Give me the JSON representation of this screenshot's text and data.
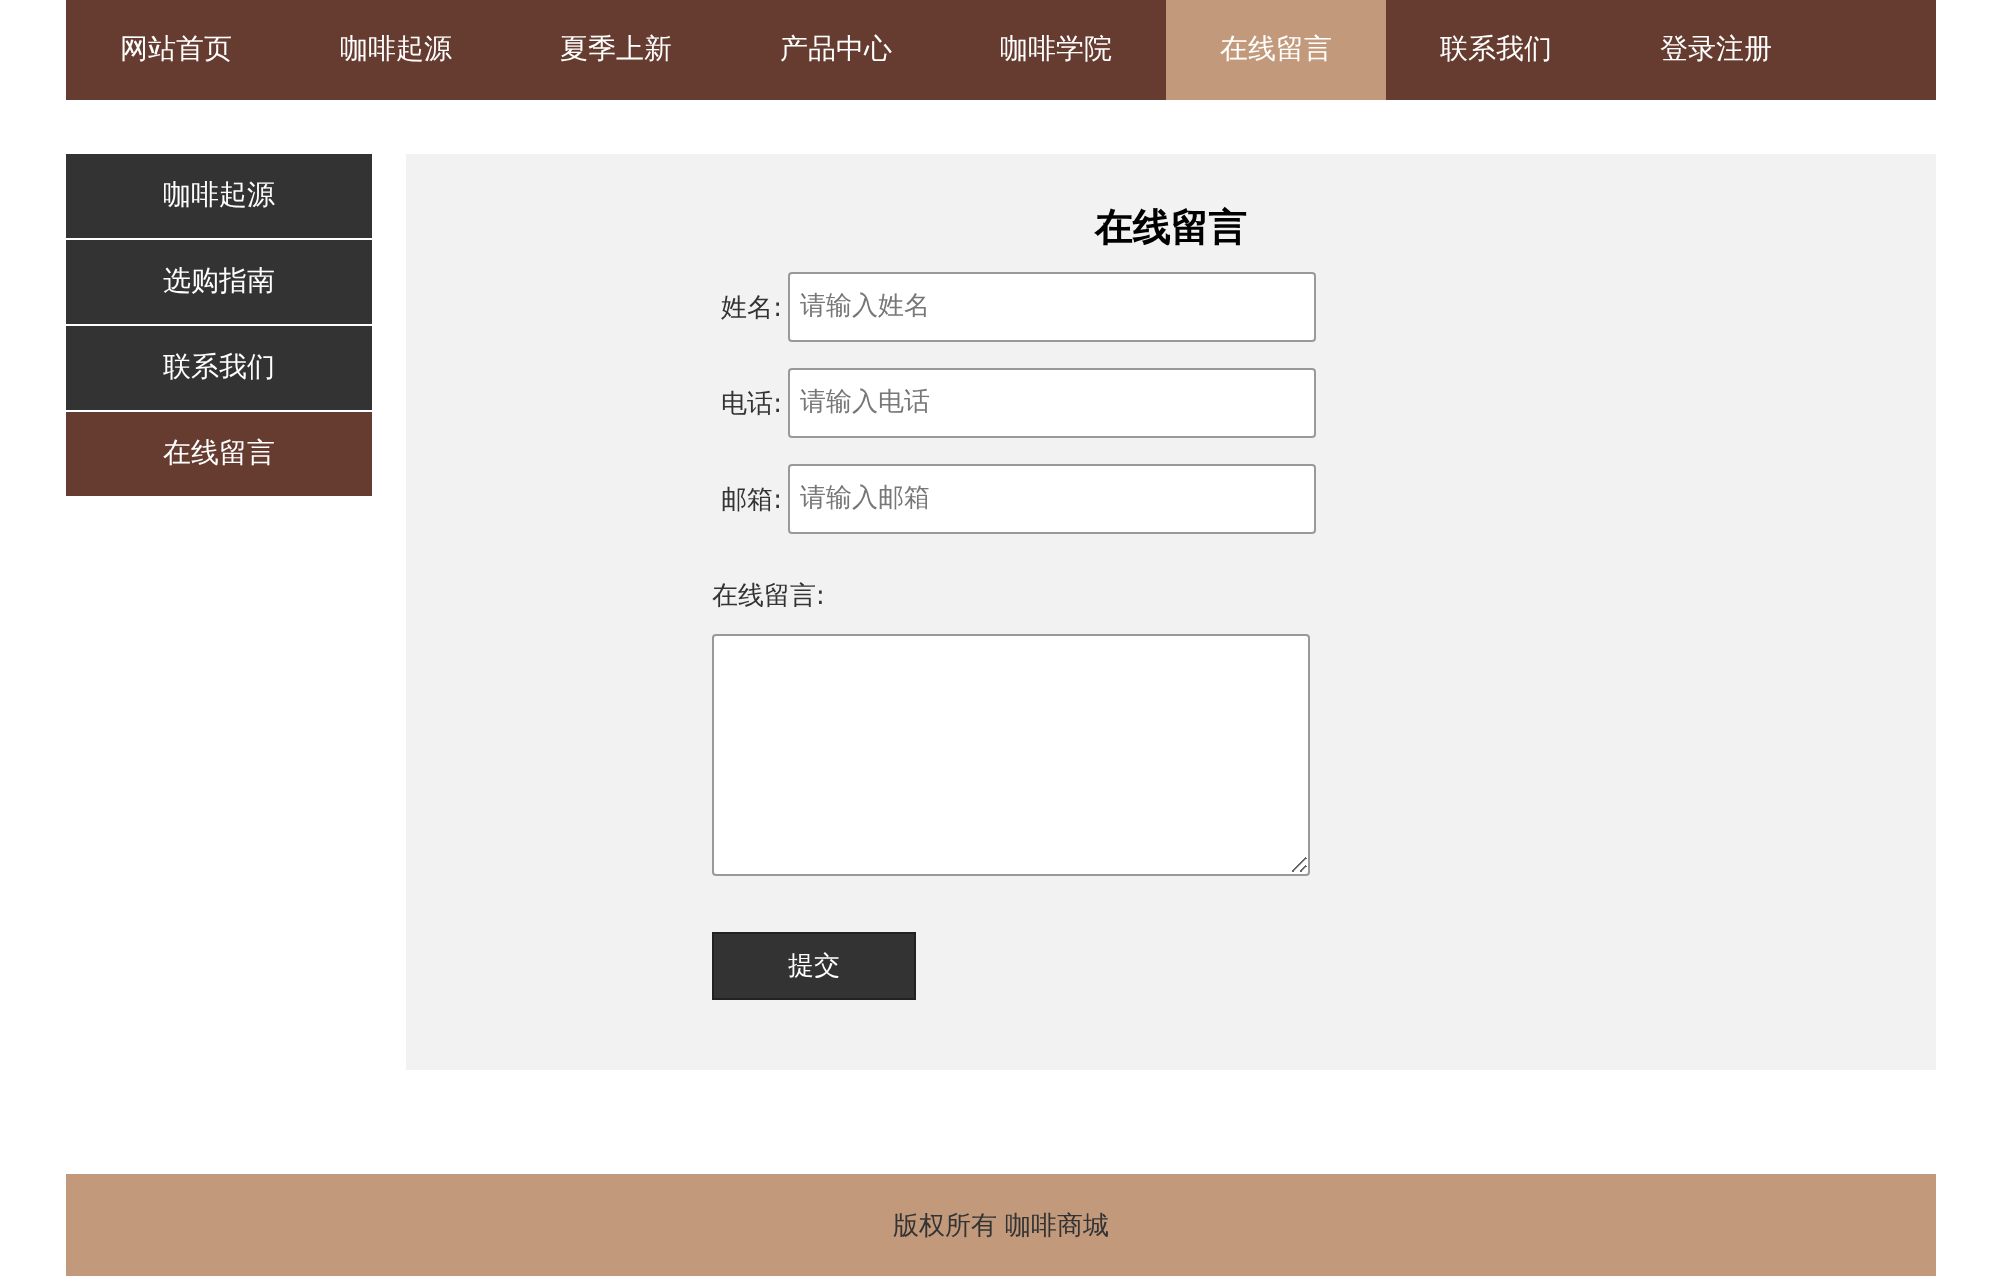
{
  "nav": {
    "items": [
      {
        "label": "网站首页",
        "selected": false
      },
      {
        "label": "咖啡起源",
        "selected": false
      },
      {
        "label": "夏季上新",
        "selected": false
      },
      {
        "label": "产品中心",
        "selected": false
      },
      {
        "label": "咖啡学院",
        "selected": false
      },
      {
        "label": "在线留言",
        "selected": true
      },
      {
        "label": "联系我们",
        "selected": false
      },
      {
        "label": "登录注册",
        "selected": false
      }
    ]
  },
  "sidebar": {
    "items": [
      {
        "label": "咖啡起源",
        "selected": false
      },
      {
        "label": "选购指南",
        "selected": false
      },
      {
        "label": "联系我们",
        "selected": false
      },
      {
        "label": "在线留言",
        "selected": true
      }
    ]
  },
  "form": {
    "title": "在线留言",
    "fields": [
      {
        "label": "姓名:",
        "placeholder": "请输入姓名"
      },
      {
        "label": "电话:",
        "placeholder": "请输入电话"
      },
      {
        "label": "邮箱:",
        "placeholder": "请输入邮箱"
      }
    ],
    "message_label": "在线留言:",
    "submit": "提交"
  },
  "footer": {
    "text": "版权所有 咖啡商城"
  }
}
